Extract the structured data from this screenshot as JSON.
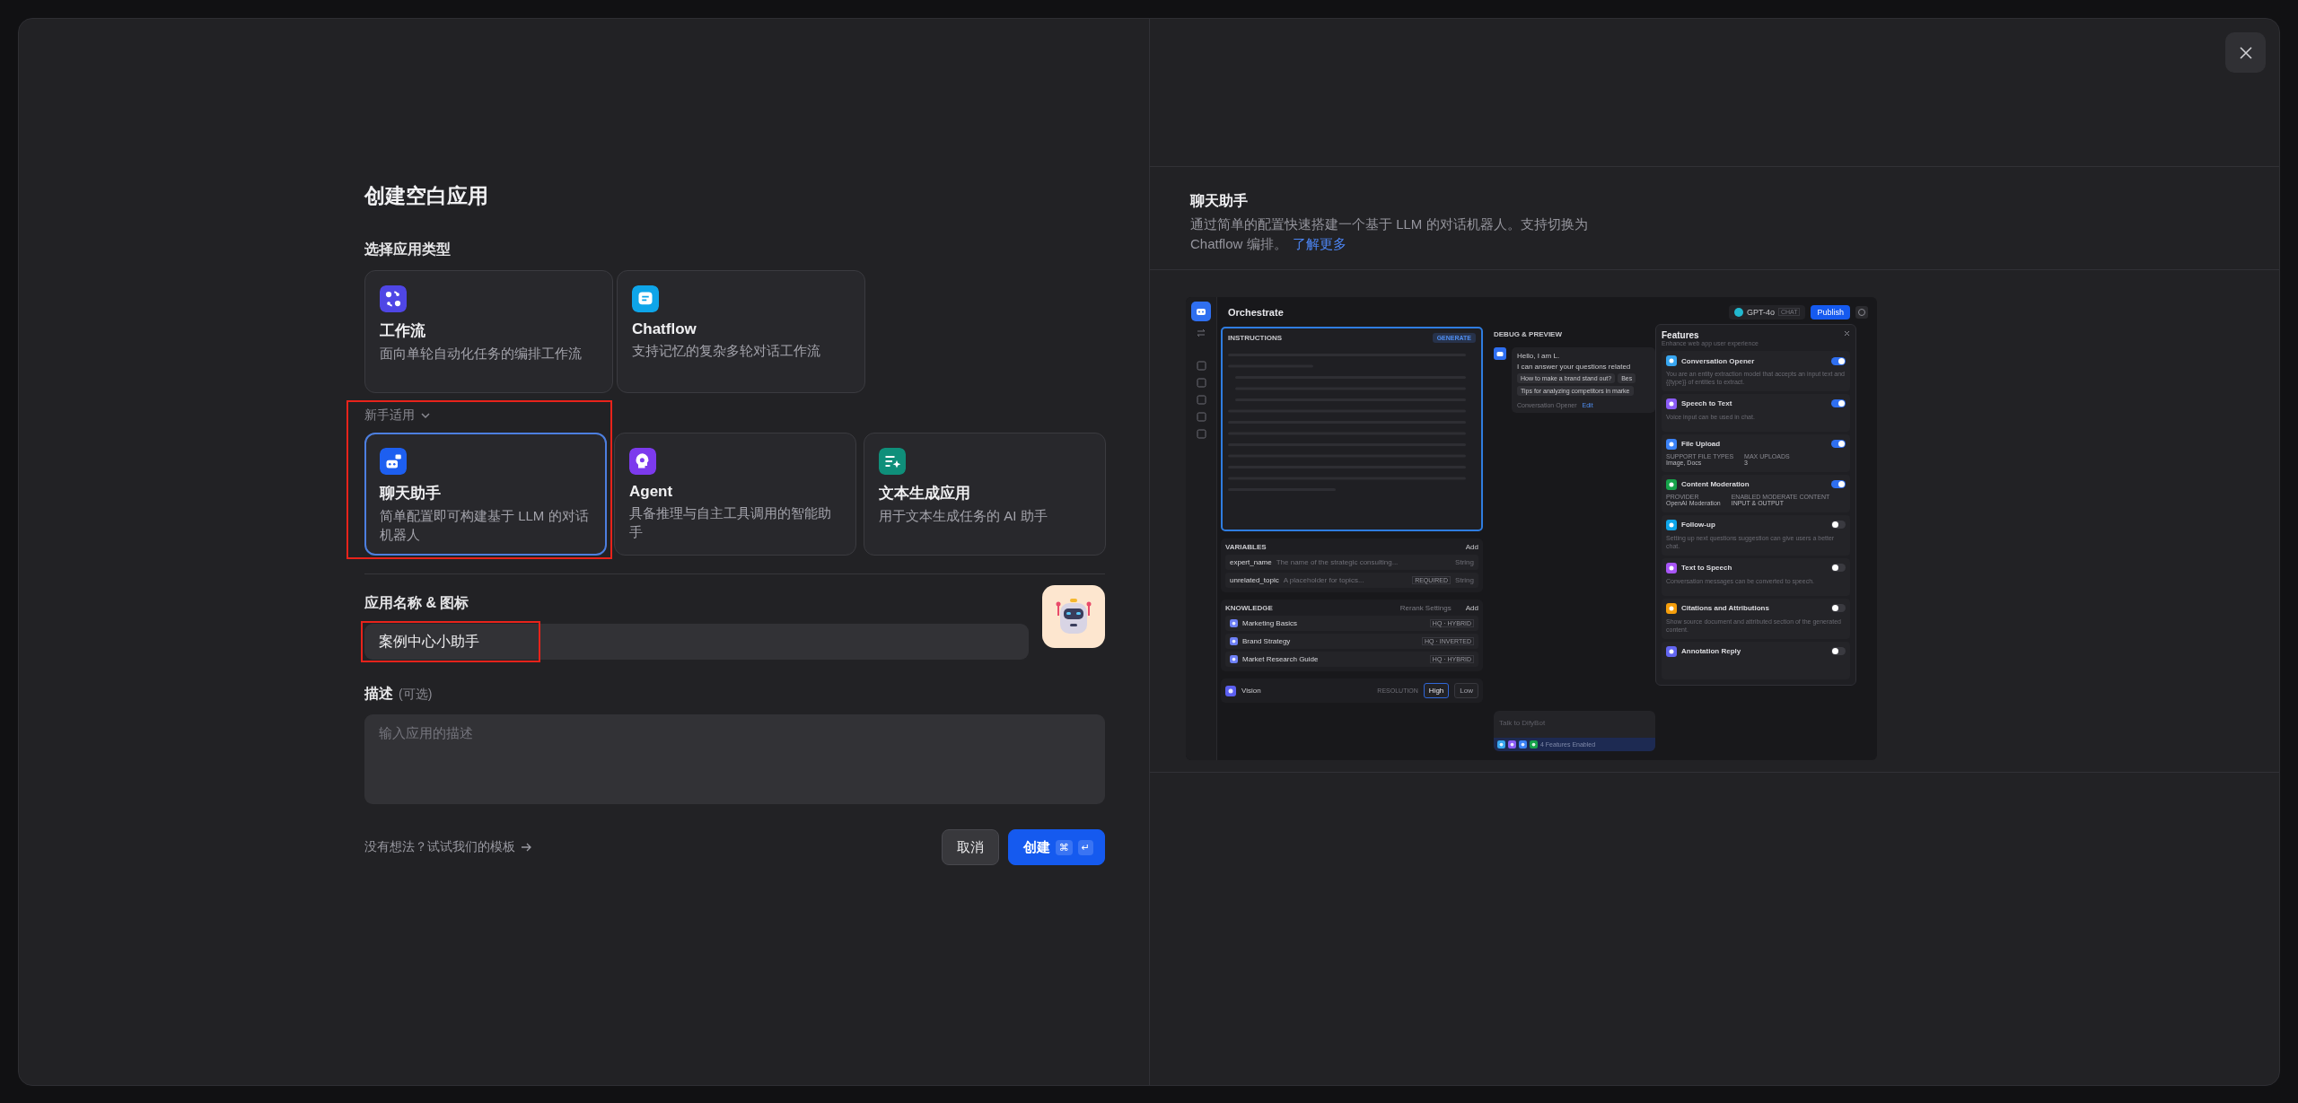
{
  "title": "创建空白应用",
  "type_section": {
    "label": "选择应用类型",
    "types": [
      {
        "kind": "workflow",
        "title": "工作流",
        "description": "面向单轮自动化任务的编排工作流",
        "color": "#4f46e5",
        "selected": false
      },
      {
        "kind": "chatflow",
        "title": "Chatflow",
        "description": "支持记忆的复杂多轮对话工作流",
        "color": "#0ea5e9",
        "selected": false
      }
    ]
  },
  "beginner": {
    "label": "新手适用",
    "expanded": true,
    "types": [
      {
        "kind": "chatbot",
        "title": "聊天助手",
        "description": "简单配置即可构建基于 LLM 的对话机器人",
        "color": "#1d5ff0",
        "selected": true,
        "highlighted": true
      },
      {
        "kind": "agent",
        "title": "Agent",
        "description": "具备推理与自主工具调用的智能助手",
        "color": "#7c3aed",
        "selected": false,
        "highlighted": false
      },
      {
        "kind": "completion",
        "title": "文本生成应用",
        "description": "用于文本生成任务的 AI 助手",
        "color": "#0f8f7a",
        "selected": false,
        "highlighted": false
      }
    ]
  },
  "name_field": {
    "label": "应用名称 & 图标",
    "value": "案例中心小助手",
    "highlighted": true
  },
  "description_field": {
    "label": "描述",
    "optional": "(可选)",
    "placeholder": "输入应用的描述"
  },
  "template_link": "没有想法？试试我们的模板",
  "buttons": {
    "cancel": "取消",
    "create": "创建",
    "keys": [
      "⌘",
      "↵"
    ]
  },
  "info": {
    "title": "聊天助手",
    "description": "通过简单的配置快速搭建一个基于 LLM 的对话机器人。支持切换为 Chatflow 编排。",
    "link": "了解更多"
  },
  "preview": {
    "title": "Orchestrate",
    "model": "GPT-4o",
    "mode": "CHAT",
    "publish": "Publish",
    "instructions": {
      "label": "INSTRUCTIONS",
      "generate": "GENERATE"
    },
    "variables": {
      "label": "VARIABLES",
      "add": "Add",
      "items": [
        {
          "name": "expert_name",
          "description": "The name of the strategic consulting...",
          "type": "String"
        },
        {
          "name": "unrelated_topic",
          "description": "A placeholder for topics...",
          "tag": "REQUIRED",
          "type": "String"
        }
      ]
    },
    "knowledge": {
      "label": "KNOWLEDGE",
      "rerank": "Rerank Settings",
      "add": "Add",
      "items": [
        {
          "name": "Marketing Basics",
          "tag": "HQ · HYBRID"
        },
        {
          "name": "Brand Strategy",
          "tag": "HQ · INVERTED"
        },
        {
          "name": "Market Research Guide",
          "tag": "HQ · HYBRID"
        }
      ]
    },
    "vision": {
      "label": "Vision",
      "resolution": "RESOLUTION",
      "options": [
        {
          "label": "High",
          "selected": true
        },
        {
          "label": "Low",
          "selected": false
        }
      ]
    },
    "debug": {
      "title": "DEBUG & PREVIEW",
      "greeting": "Hello, I am L.",
      "intro": "I can answer your questions related",
      "suggestions": [
        "How to make a brand stand out?",
        "Bes",
        "Tips for analyzing competitors in marke"
      ],
      "opener": "Conversation Opener",
      "edit": "Edit",
      "placeholder": "Talk to DifyBot",
      "enabled": "4 Features Enabled"
    },
    "features": {
      "title": "Features",
      "subtitle": "Enhance web app user experience",
      "items": [
        {
          "name": "Conversation Opener",
          "color": "#38a6f0",
          "on": true,
          "description": "You are an entity extraction model that accepts an input text and {{type}} of entities to extract."
        },
        {
          "name": "Speech to Text",
          "color": "#8b5cf6",
          "on": true,
          "description": "Voice input can be used in chat."
        },
        {
          "name": "File Upload",
          "color": "#3b82f6",
          "on": true,
          "details": [
            {
              "label": "SUPPORT FILE TYPES",
              "value": "Image, Docs"
            },
            {
              "label": "MAX UPLOADS",
              "value": "3"
            }
          ]
        },
        {
          "name": "Content Moderation",
          "color": "#16a34a",
          "on": true,
          "details": [
            {
              "label": "PROVIDER",
              "value": "OpenAI Moderation"
            },
            {
              "label": "ENABLED MODERATE CONTENT",
              "value": "INPUT & OUTPUT"
            }
          ]
        },
        {
          "name": "Follow-up",
          "color": "#0ea5e9",
          "on": false,
          "description": "Setting up next questions suggestion can give users a better chat."
        },
        {
          "name": "Text to Speech",
          "color": "#a855f7",
          "on": false,
          "description": "Conversation messages can be converted to speech."
        },
        {
          "name": "Citations and Attributions",
          "color": "#f59e0b",
          "on": false,
          "description": "Show source document and attributed section of the generated content."
        },
        {
          "name": "Annotation Reply",
          "color": "#6366f1",
          "on": false
        }
      ]
    }
  }
}
